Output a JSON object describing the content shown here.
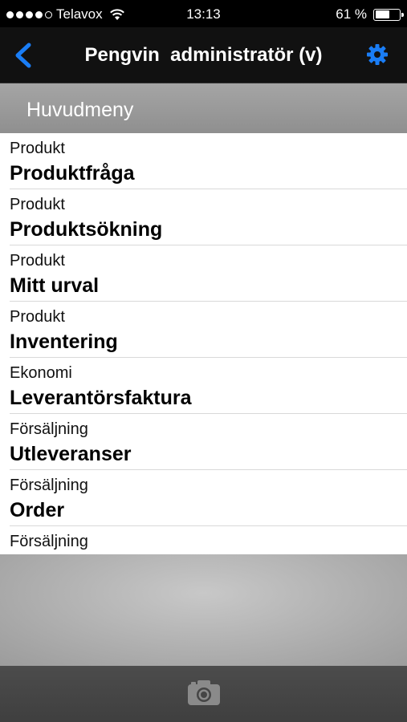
{
  "status_bar": {
    "carrier": "Telavox",
    "time": "13:13",
    "battery_text": "61 %",
    "battery_level": 0.61,
    "signal_bars_filled": 4,
    "signal_bars_total": 5
  },
  "nav": {
    "title": "Pengvin  administratör (v)",
    "back_icon": "chevron-left-icon",
    "settings_icon": "gear-icon",
    "accent_color": "#1a7df5"
  },
  "section": {
    "title": "Huvudmeny"
  },
  "menu_items": [
    {
      "category": "Produkt",
      "title": "Produktfråga"
    },
    {
      "category": "Produkt",
      "title": "Produktsökning"
    },
    {
      "category": "Produkt",
      "title": "Mitt urval"
    },
    {
      "category": "Produkt",
      "title": "Inventering"
    },
    {
      "category": "Ekonomi",
      "title": "Leverantörsfaktura"
    },
    {
      "category": "Försäljning",
      "title": "Utleveranser"
    },
    {
      "category": "Försäljning",
      "title": "Order"
    },
    {
      "category": "Försäljning",
      "title": ""
    }
  ],
  "toolbar": {
    "camera_icon": "camera-icon"
  }
}
